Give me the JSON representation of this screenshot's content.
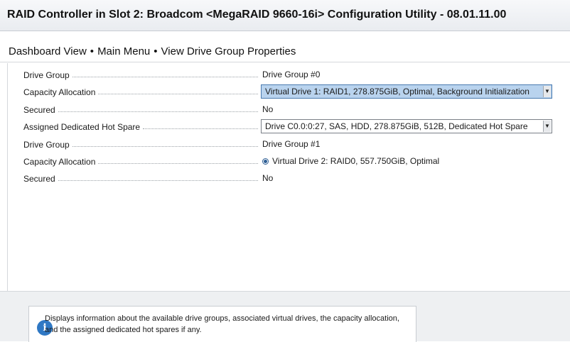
{
  "window": {
    "title": "RAID Controller in Slot 2: Broadcom <MegaRAID 9660-16i> Configuration Utility - 08.01.11.00"
  },
  "breadcrumb": {
    "items": [
      "Dashboard View",
      "Main Menu",
      "View Drive Group Properties"
    ],
    "separator": "•"
  },
  "properties": [
    {
      "label": "Drive Group",
      "value": "Drive Group #0"
    },
    {
      "label": "Capacity Allocation",
      "value": "Virtual Drive 1: RAID1, 278.875GiB, Optimal, Background Initialization"
    },
    {
      "label": "Secured",
      "value": "No"
    },
    {
      "label": "Assigned Dedicated Hot Spare",
      "value": "Drive C0.0:0:27, SAS, HDD, 278.875GiB, 512B, Dedicated Hot Spare"
    },
    {
      "label": "Drive Group",
      "value": "Drive Group #1"
    },
    {
      "label": "Capacity Allocation",
      "value": "Virtual Drive 2: RAID0, 557.750GiB, Optimal"
    },
    {
      "label": "Secured",
      "value": "No"
    }
  ],
  "help": {
    "text": "Displays information about the available drive groups, associated virtual drives, the capacity allocation, and the assigned dedicated hot spares if any.",
    "icon": "info-icon"
  },
  "colors": {
    "highlight": "#b9d3ee",
    "info_icon": "#2f78c4"
  }
}
